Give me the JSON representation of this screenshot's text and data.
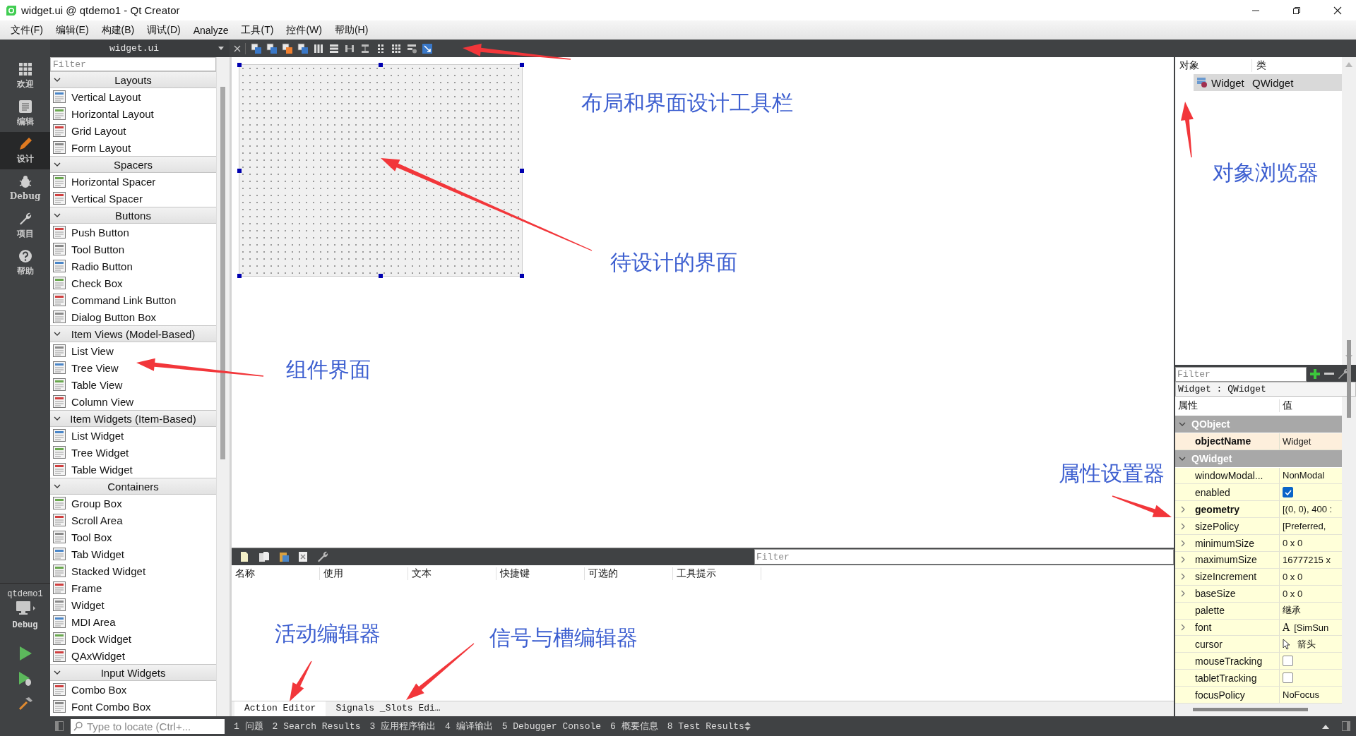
{
  "window": {
    "title": "widget.ui @ qtdemo1 - Qt Creator"
  },
  "menu": [
    "文件(F)",
    "编辑(E)",
    "构建(B)",
    "调试(D)",
    "Analyze",
    "工具(T)",
    "控件(W)",
    "帮助(H)"
  ],
  "mode_bar": {
    "items": [
      {
        "label": "欢迎",
        "selected": false
      },
      {
        "label": "编辑",
        "selected": false
      },
      {
        "label": "设计",
        "selected": true
      },
      {
        "label": "Debug",
        "selected": false
      },
      {
        "label": "项目",
        "selected": false
      },
      {
        "label": "帮助",
        "selected": false
      }
    ],
    "kit": {
      "project": "qtdemo1",
      "config": "Debug"
    }
  },
  "editor_tab": {
    "label": "widget.ui"
  },
  "widget_box": {
    "filter": {
      "placeholder": "Filter"
    },
    "categories": [
      {
        "title": "Layouts",
        "expanded": true,
        "items": [
          "Vertical Layout",
          "Horizontal Layout",
          "Grid Layout",
          "Form Layout"
        ]
      },
      {
        "title": "Spacers",
        "expanded": true,
        "items": [
          "Horizontal Spacer",
          "Vertical Spacer"
        ]
      },
      {
        "title": "Buttons",
        "expanded": true,
        "items": [
          "Push Button",
          "Tool Button",
          "Radio Button",
          "Check Box",
          "Command Link Button",
          "Dialog Button Box"
        ]
      },
      {
        "title": "Item Views (Model-Based)",
        "expanded": true,
        "items": [
          "List View",
          "Tree View",
          "Table View",
          "Column View"
        ]
      },
      {
        "title": "Item Widgets (Item-Based)",
        "expanded": true,
        "items": [
          "List Widget",
          "Tree Widget",
          "Table Widget"
        ]
      },
      {
        "title": "Containers",
        "expanded": true,
        "items": [
          "Group Box",
          "Scroll Area",
          "Tool Box",
          "Tab Widget",
          "Stacked Widget",
          "Frame",
          "Widget",
          "MDI Area",
          "Dock Widget",
          "QAxWidget"
        ]
      },
      {
        "title": "Input Widgets",
        "expanded": true,
        "items": [
          "Combo Box",
          "Font Combo Box"
        ]
      }
    ]
  },
  "object_inspector": {
    "columns": [
      "对象",
      "类"
    ],
    "rows": [
      {
        "object": "Widget",
        "class": "QWidget",
        "selected": true
      }
    ]
  },
  "property_editor": {
    "filter": {
      "placeholder": "Filter"
    },
    "object_label": "Widget : QWidget",
    "columns": [
      "属性",
      "值"
    ],
    "rows": [
      {
        "kind": "group",
        "name": "QObject",
        "expanded": true
      },
      {
        "kind": "text",
        "name": "objectName",
        "bold": true,
        "expandable": false,
        "value": "Widget"
      },
      {
        "kind": "group",
        "name": "QWidget",
        "expanded": true
      },
      {
        "kind": "text",
        "name": "windowModal...",
        "bold": false,
        "expandable": false,
        "value": "NonModal"
      },
      {
        "kind": "check",
        "name": "enabled",
        "bold": false,
        "expandable": false,
        "checked": true
      },
      {
        "kind": "text",
        "name": "geometry",
        "bold": true,
        "expandable": true,
        "value": "[(0, 0), 400 :"
      },
      {
        "kind": "text",
        "name": "sizePolicy",
        "bold": false,
        "expandable": true,
        "value": "[Preferred,"
      },
      {
        "kind": "text",
        "name": "minimumSize",
        "bold": false,
        "expandable": true,
        "value": "0 x 0"
      },
      {
        "kind": "text",
        "name": "maximumSize",
        "bold": false,
        "expandable": true,
        "value": "16777215 x"
      },
      {
        "kind": "text",
        "name": "sizeIncrement",
        "bold": false,
        "expandable": true,
        "value": "0 x 0"
      },
      {
        "kind": "text",
        "name": "baseSize",
        "bold": false,
        "expandable": true,
        "value": "0 x 0"
      },
      {
        "kind": "text",
        "name": "palette",
        "bold": false,
        "expandable": false,
        "value": "继承"
      },
      {
        "kind": "font",
        "name": "font",
        "bold": false,
        "expandable": true,
        "glyph": "A",
        "value": "[SimSun"
      },
      {
        "kind": "cursor",
        "name": "cursor",
        "bold": false,
        "expandable": false,
        "value": "箭头"
      },
      {
        "kind": "check",
        "name": "mouseTracking",
        "bold": false,
        "expandable": false,
        "checked": false
      },
      {
        "kind": "check",
        "name": "tabletTracking",
        "bold": false,
        "expandable": false,
        "checked": false
      },
      {
        "kind": "text",
        "name": "focusPolicy",
        "bold": false,
        "expandable": false,
        "value": "NoFocus"
      }
    ]
  },
  "action_editor": {
    "filter": {
      "placeholder": "Filter"
    },
    "columns": [
      "名称",
      "使用",
      "文本",
      "快捷键",
      "可选的",
      "工具提示"
    ],
    "tabs": [
      {
        "label": "Action Editor",
        "selected": true
      },
      {
        "label": "Signals _Slots Edi…",
        "selected": false
      }
    ]
  },
  "status_bar": {
    "search": {
      "placeholder": "Type to locate (Ctrl+..."
    },
    "panes": [
      "1 问题",
      "2 Search Results",
      "3 应用程序输出",
      "4 编译输出",
      "5 Debugger Console",
      "6 概要信息",
      "8 Test Results"
    ]
  },
  "annotations": [
    {
      "text": "布局和界面设计工具栏"
    },
    {
      "text": "待设计的界面"
    },
    {
      "text": "组件界面"
    },
    {
      "text": "对象浏览器"
    },
    {
      "text": "属性设置器"
    },
    {
      "text": "活动编辑器"
    },
    {
      "text": "信号与槽编辑器"
    }
  ]
}
